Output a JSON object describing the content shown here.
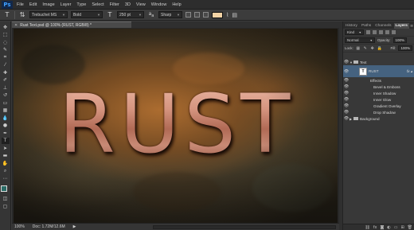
{
  "app": {
    "logo": "Ps"
  },
  "menu": [
    "File",
    "Edit",
    "Image",
    "Layer",
    "Type",
    "Select",
    "Filter",
    "3D",
    "View",
    "Window",
    "Help"
  ],
  "options": {
    "font_family": "Trebuchet MS",
    "font_style": "Bold",
    "font_size": "250 pt",
    "antialias": "Sharp",
    "text_color": "#f3d3a5"
  },
  "document": {
    "tab_title": "Rust Text.psd @ 100% (RUST, RGB/8) *",
    "canvas_text": "RUST"
  },
  "status": {
    "zoom": "100%",
    "doc_size": "Doc: 1.72M/12.6M"
  },
  "panel": {
    "tabs": [
      "History",
      "Paths",
      "Channels",
      "Layers"
    ],
    "active_tab": "Layers",
    "filter_kind": "Kind",
    "blend_mode": "Normal",
    "opacity_label": "Opacity:",
    "opacity_value": "100%",
    "lock_label": "Lock:",
    "fill_label": "Fill:",
    "fill_value": "100%"
  },
  "layers": {
    "group_name": "Text",
    "layer_name": "RUST",
    "effects_label": "Effects",
    "effects": [
      "Bevel & Emboss",
      "Inner Shadow",
      "Inner Glow",
      "Gradient Overlay",
      "Drop Shadow"
    ],
    "background_name": "Background"
  }
}
